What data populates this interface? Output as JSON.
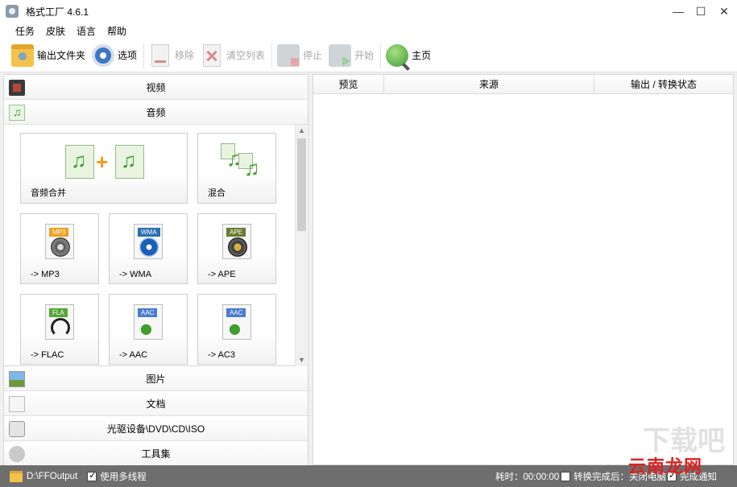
{
  "window": {
    "title": "格式工厂 4.6.1"
  },
  "menu": [
    "任务",
    "皮肤",
    "语言",
    "帮助"
  ],
  "toolbar": {
    "output_folder": "输出文件夹",
    "options": "选项",
    "remove": "移除",
    "clear_list": "清空列表",
    "stop": "停止",
    "start": "开始",
    "home": "主页"
  },
  "categories": {
    "video": "视频",
    "audio": "音频",
    "picture": "图片",
    "document": "文档",
    "disc": "光驱设备\\DVD\\CD\\ISO",
    "tools": "工具集"
  },
  "audio_tiles": [
    {
      "label": "音频合并"
    },
    {
      "label": "混合"
    },
    {
      "label": "-> MP3",
      "tag": "MP3",
      "tag_color": "#f0a020"
    },
    {
      "label": "-> WMA",
      "tag": "WMA",
      "tag_color": "#2a6fb0"
    },
    {
      "label": "-> APE",
      "tag": "APE",
      "tag_color": "#6a7a30"
    },
    {
      "label": "-> FLAC",
      "tag": "FLA",
      "tag_color": "#55a832"
    },
    {
      "label": "-> AAC",
      "tag": "AAC",
      "tag_color": "#4a7bd0"
    },
    {
      "label": "-> AC3",
      "tag": "AAC",
      "tag_color": "#4a7bd0"
    }
  ],
  "task_columns": [
    "预览",
    "来源",
    "输出 / 转换状态"
  ],
  "status": {
    "output_path": "D:\\FFOutput",
    "multithread": "使用多线程",
    "elapsed": "耗时：00:00:00",
    "after_done": "转换完成后：关闭电脑",
    "notify": "完成通知"
  },
  "watermark": {
    "bg": "下载吧",
    "text": "云南龙网"
  },
  "colors": {
    "statusbar": "#6e6e6e",
    "accent_green": "#3f9f2d",
    "plus": "#f29a1c"
  }
}
